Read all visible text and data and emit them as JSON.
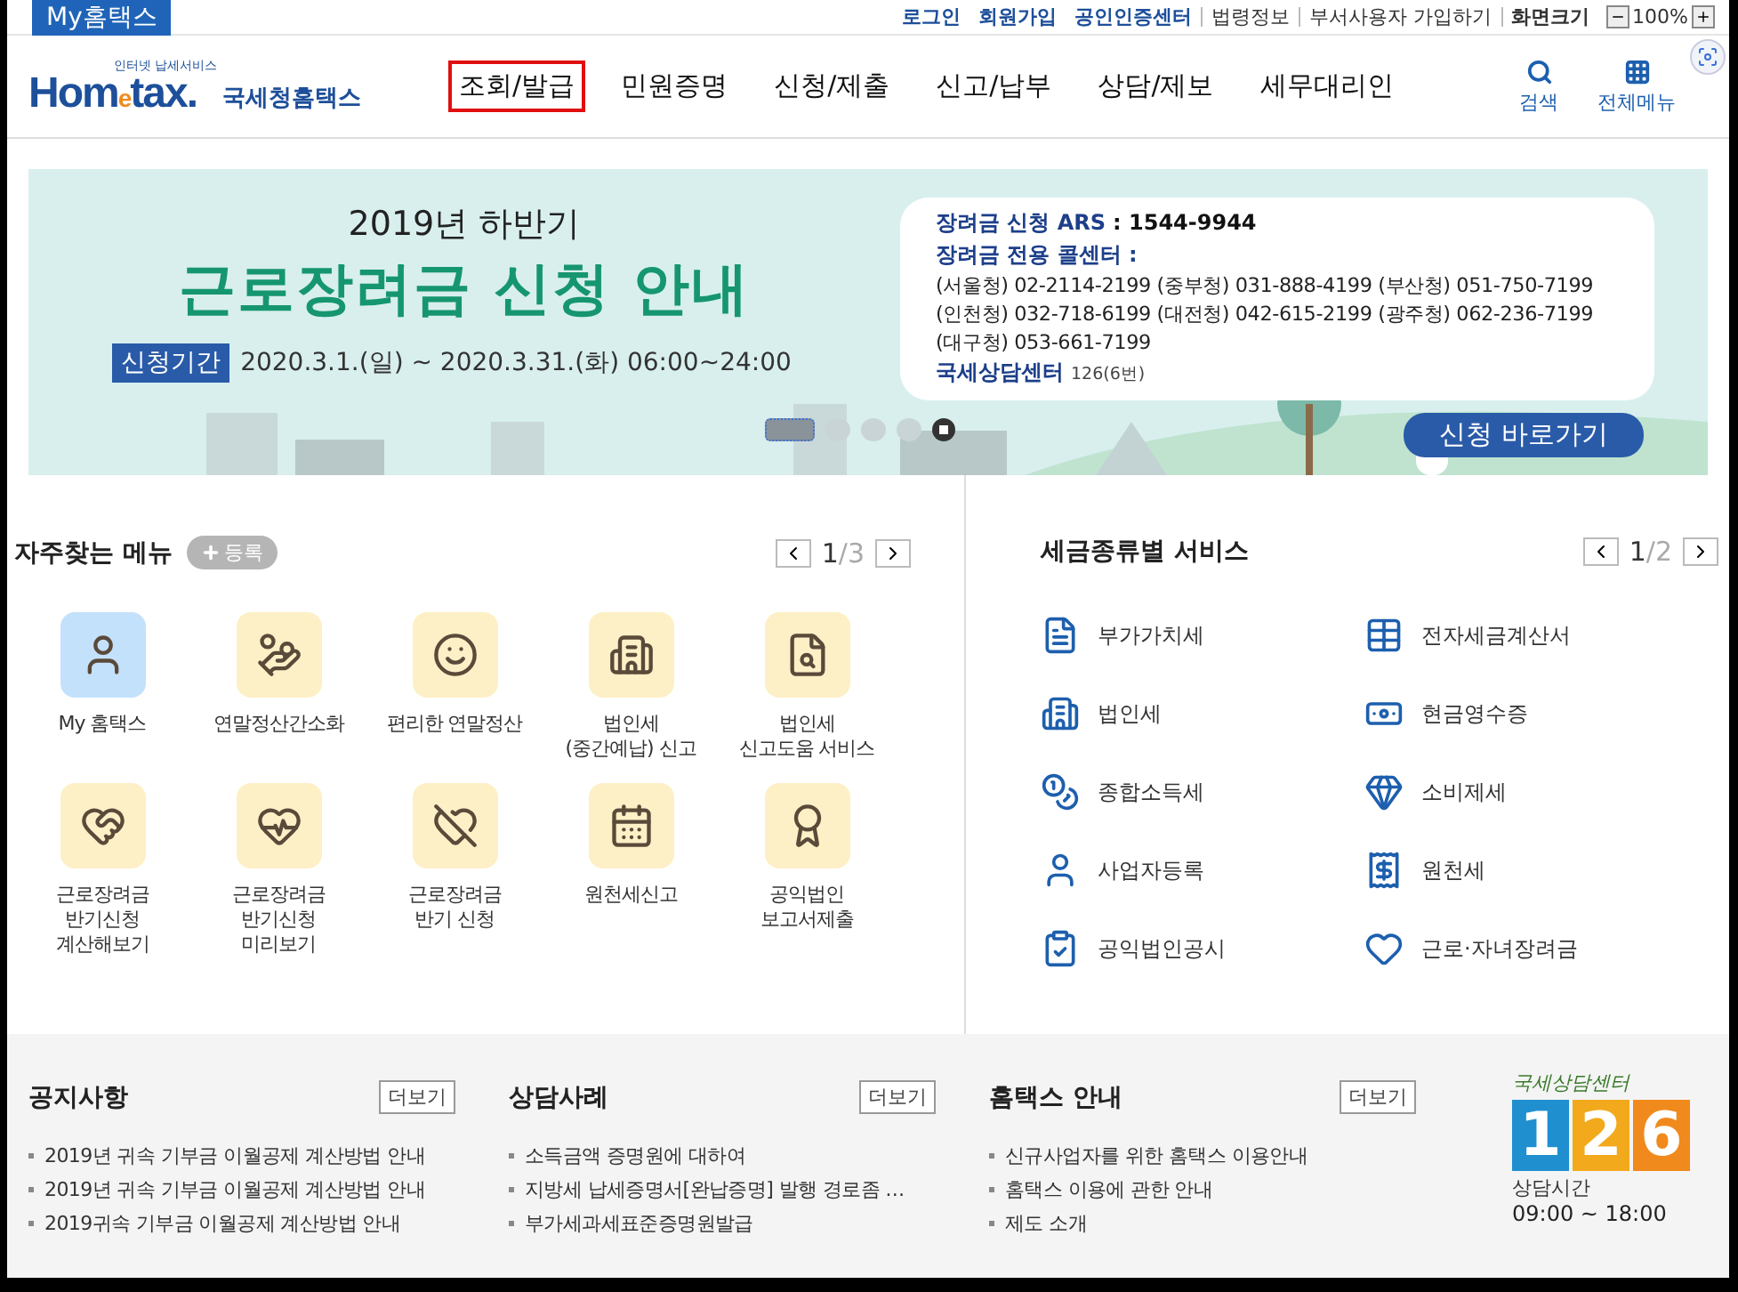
{
  "top_bar": {
    "my_tab": "My홈택스",
    "links": [
      {
        "label": "로그인",
        "kind": "strong"
      },
      {
        "label": "회원가입",
        "kind": "strong"
      },
      {
        "label": "공인인증센터",
        "kind": "strong"
      },
      {
        "label": "법령정보",
        "kind": "plain"
      },
      {
        "label": "부서사용자 가입하기",
        "kind": "plain"
      },
      {
        "label": "화면크기",
        "kind": "dark"
      }
    ],
    "zoom": "100%"
  },
  "header": {
    "logo": {
      "tagline": "인터넷 납세서비스",
      "brand_a": "Hom",
      "brand_e": "e",
      "brand_b": "tax.",
      "name": "국세청홈택스"
    },
    "nav": [
      {
        "label": "조회/발급",
        "selected": true
      },
      {
        "label": "민원증명",
        "selected": false
      },
      {
        "label": "신청/제출",
        "selected": false
      },
      {
        "label": "신고/납부",
        "selected": false
      },
      {
        "label": "상담/제보",
        "selected": false
      },
      {
        "label": "세무대리인",
        "selected": false
      }
    ],
    "search": "검색",
    "all_menu": "전체메뉴"
  },
  "banner": {
    "subtitle": "2019년 하반기",
    "title": "근로장려금 신청 안내",
    "period_label": "신청기간",
    "period": "2020.3.1.(일) ~ 2020.3.31.(화) 06:00~24:00",
    "info": {
      "ars_label": "장려금 신청 ARS",
      "ars_value": ": 1544-9944",
      "center_label": "장려금 전용 콜센터 :",
      "phones": [
        "(서울청) 02-2114-2199 (중부청) 031-888-4199 (부산청) 051-750-7199",
        "(인천청) 032-718-6199 (대전청) 042-615-2199 (광주청) 062-236-7199",
        "(대구청) 053-661-7199"
      ],
      "nts_label": "국세상담센터",
      "nts_value": "126(6번)"
    },
    "slides": [
      {
        "selected": true
      },
      {
        "selected": false
      },
      {
        "selected": false
      },
      {
        "selected": false
      }
    ],
    "button": "신청 바로가기"
  },
  "frequent_menu": {
    "title": "자주찾는 메뉴",
    "register": "등록",
    "page": "1",
    "pages": "/3",
    "items": [
      {
        "label": "My 홈택스",
        "kind": "personal"
      },
      {
        "label": "연말정산간소화",
        "kind": "service"
      },
      {
        "label": "편리한 연말정산",
        "kind": "service"
      },
      {
        "label": "법인세\n(중간예납) 신고",
        "kind": "service"
      },
      {
        "label": "법인세\n신고도움 서비스",
        "kind": "service"
      },
      {
        "label": "근로장려금\n반기신청\n계산해보기",
        "kind": "service"
      },
      {
        "label": "근로장려금\n반기신청\n미리보기",
        "kind": "service"
      },
      {
        "label": "근로장려금\n반기 신청",
        "kind": "service"
      },
      {
        "label": "원천세신고",
        "kind": "service"
      },
      {
        "label": "공익법인\n보고서제출",
        "kind": "service"
      }
    ]
  },
  "tax_services": {
    "title": "세금종류별 서비스",
    "page": "1",
    "pages": "/2",
    "items": [
      "부가가치세",
      "전자세금계산서",
      "법인세",
      "현금영수증",
      "종합소득세",
      "소비제세",
      "사업자등록",
      "원천세",
      "공익법인공시",
      "근로·자녀장려금"
    ]
  },
  "footer": {
    "boards": [
      {
        "title": "공지사항",
        "more": "더보기",
        "items": [
          "2019년 귀속 기부금 이월공제 계산방법 안내",
          "2019년 귀속 기부금 이월공제 계산방법 안내",
          "2019귀속 기부금 이월공제 계산방법 안내"
        ]
      },
      {
        "title": "상담사례",
        "more": "더보기",
        "items": [
          "소득금액 증명원에 대하여",
          "지방세 납세증명서[완납증명] 발행 경로좀 …",
          "부가세과세표준증명원발급"
        ]
      },
      {
        "title": "홈택스 안내",
        "more": "더보기",
        "items": [
          "신규사업자를 위한 홈택스 이용안내",
          "홈택스 이용에 관한 안내",
          "제도 소개"
        ]
      }
    ],
    "center": {
      "title": "국세상담센터",
      "digits": [
        {
          "label": "1",
          "color": "#1f8fd0"
        },
        {
          "label": "2",
          "color": "#f2a91c"
        },
        {
          "label": "6",
          "color": "#f08a1c"
        }
      ],
      "hours_label": "상담시간",
      "hours": "09:00 ~ 18:00"
    }
  }
}
